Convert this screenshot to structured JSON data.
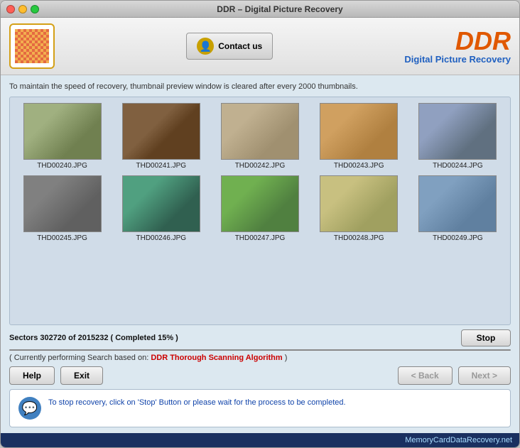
{
  "window": {
    "title": "DDR – Digital Picture Recovery"
  },
  "header": {
    "contact_label": "Contact us",
    "ddr_title": "DDR",
    "ddr_subtitle": "Digital Picture Recovery"
  },
  "notice": {
    "text": "To maintain the speed of recovery, thumbnail preview window is cleared after every 2000 thumbnails."
  },
  "thumbnails": [
    {
      "id": "THD00240",
      "label": "THD00240.JPG",
      "cls": "img-240"
    },
    {
      "id": "THD00241",
      "label": "THD00241.JPG",
      "cls": "img-241"
    },
    {
      "id": "THD00242",
      "label": "THD00242.JPG",
      "cls": "img-242"
    },
    {
      "id": "THD00243",
      "label": "THD00243.JPG",
      "cls": "img-243"
    },
    {
      "id": "THD00244",
      "label": "THD00244.JPG",
      "cls": "img-244"
    },
    {
      "id": "THD00245",
      "label": "THD00245.JPG",
      "cls": "img-245"
    },
    {
      "id": "THD00246",
      "label": "THD00246.JPG",
      "cls": "img-246"
    },
    {
      "id": "THD00247",
      "label": "THD00247.JPG",
      "cls": "img-247"
    },
    {
      "id": "THD00248",
      "label": "THD00248.JPG",
      "cls": "img-248"
    },
    {
      "id": "THD00249",
      "label": "THD00249.JPG",
      "cls": "img-249"
    }
  ],
  "progress": {
    "sectors_text": "Sectors 302720 of 2015232   ( Completed 15% )",
    "percent": 15,
    "stop_label": "Stop",
    "scanning_prefix": "( Currently performing Search based on: ",
    "scanning_algo": "DDR Thorough Scanning Algorithm",
    "scanning_suffix": " )"
  },
  "nav_buttons": {
    "help_label": "Help",
    "exit_label": "Exit",
    "back_label": "< Back",
    "next_label": "Next >"
  },
  "message": {
    "text": "To stop recovery, click on 'Stop' Button or please wait for the process to be completed."
  },
  "footer": {
    "text": "MemoryCardDataRecovery.net"
  }
}
